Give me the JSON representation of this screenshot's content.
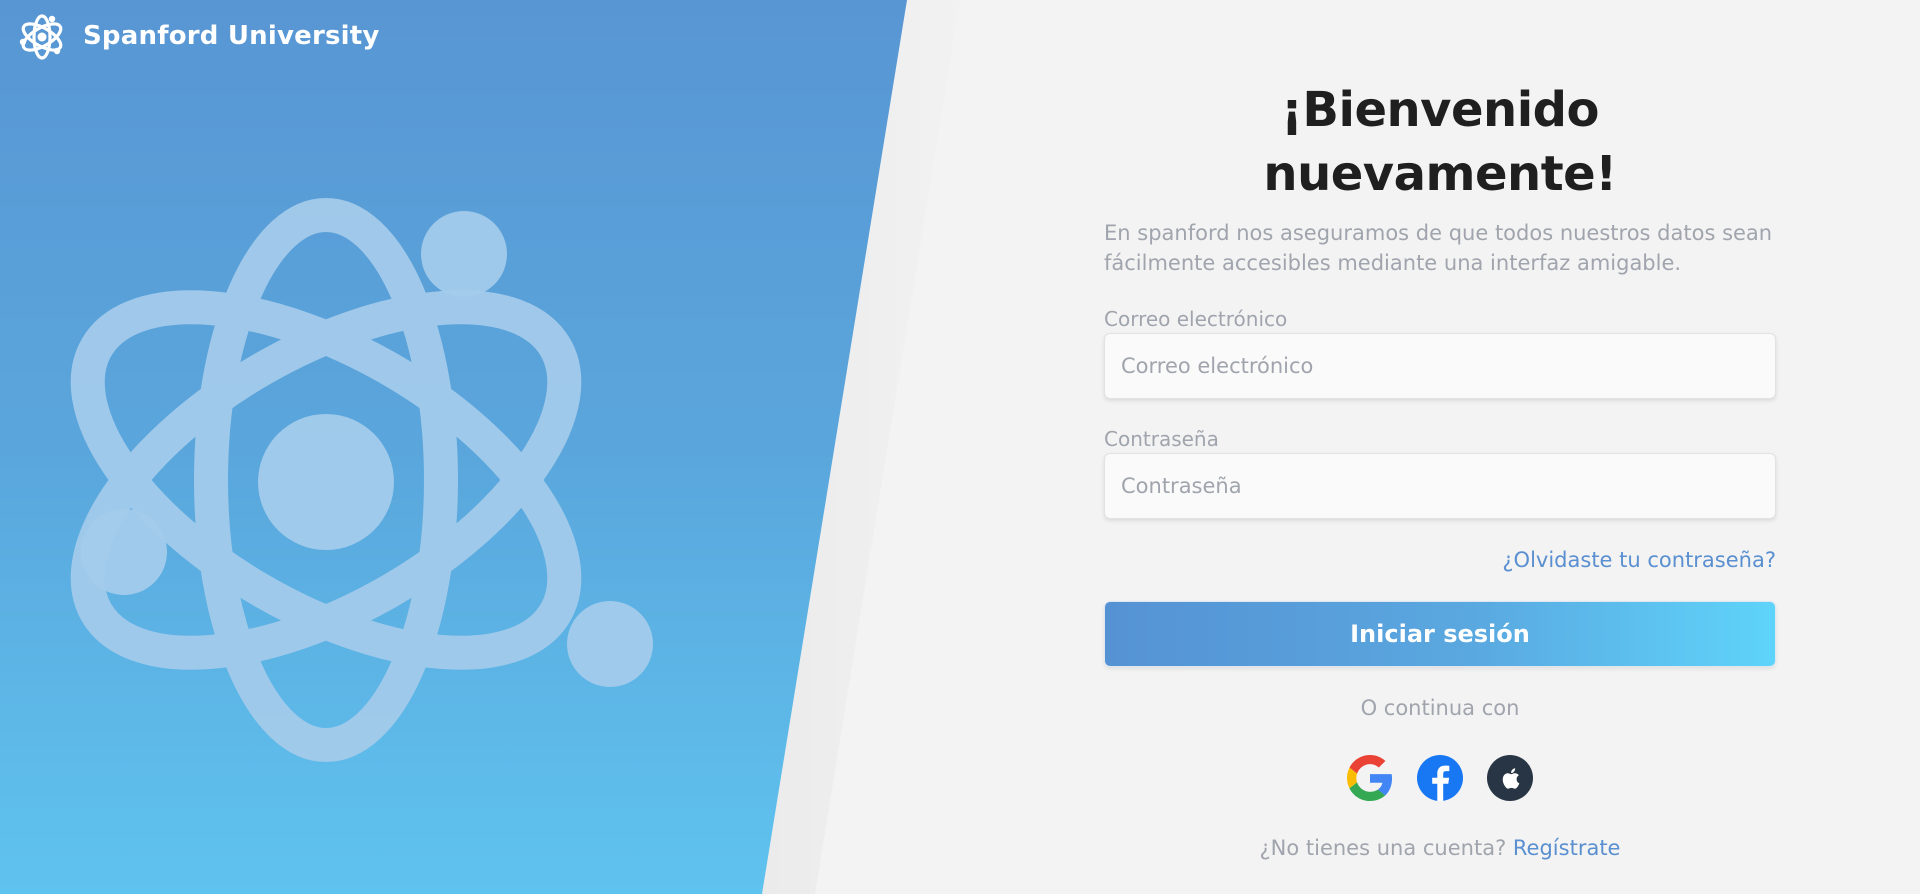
{
  "brand": {
    "name": "Spanford University",
    "logo_icon": "atom-icon"
  },
  "hero": {
    "illustration_icon": "atom-icon",
    "gradient_top": "#5896d3",
    "gradient_bottom": "#5fc3ef"
  },
  "login": {
    "title": "¡Bienvenido nuevamente!",
    "subtitle": "En spanford nos aseguramos de que todos nuestros datos sean fácilmente accesibles mediante una interfaz amigable.",
    "email_label": "Correo electrónico",
    "email_placeholder": "Correo electrónico",
    "email_value": "",
    "password_label": "Contraseña",
    "password_placeholder": "Contraseña",
    "password_value": "",
    "forgot_link": "¿Olvidaste tu contraseña?",
    "submit_label": "Iniciar sesión",
    "continue_text": "O continua con",
    "social_providers": [
      {
        "name": "Google",
        "icon": "google-icon"
      },
      {
        "name": "Facebook",
        "icon": "facebook-icon"
      },
      {
        "name": "Apple",
        "icon": "apple-icon"
      }
    ],
    "no_account_text": "¿No tienes una cuenta?",
    "signup_link": "Regístrate"
  },
  "colors": {
    "accent": "#5a8fd0",
    "muted_text": "#a0a4ad",
    "title_text": "#1f1f1f",
    "background": "#f3f3f3"
  }
}
